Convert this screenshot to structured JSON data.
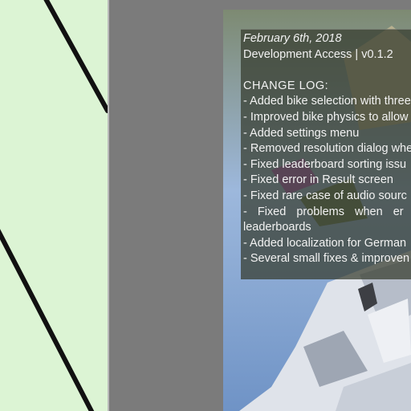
{
  "changelog": {
    "date": "February 6th, 2018",
    "version": "Development Access | v0.1.2",
    "heading": "CHANGE LOG:",
    "items": [
      "- Added bike selection with three",
      "- Improved bike physics to allow",
      "- Added settings menu",
      "- Removed resolution dialog when",
      "- Fixed leaderboard sorting issu",
      "- Fixed error in Result screen",
      "- Fixed rare case of audio sourc",
      "- Fixed problems when er",
      "leaderboards",
      "- Added localization for German",
      "- Several small fixes & improven"
    ]
  },
  "colors": {
    "left_panel": "#dcf4d4",
    "gray_area": "#7b7b7b",
    "overlay": "#343a2c",
    "sky": "#8fb0d8"
  }
}
